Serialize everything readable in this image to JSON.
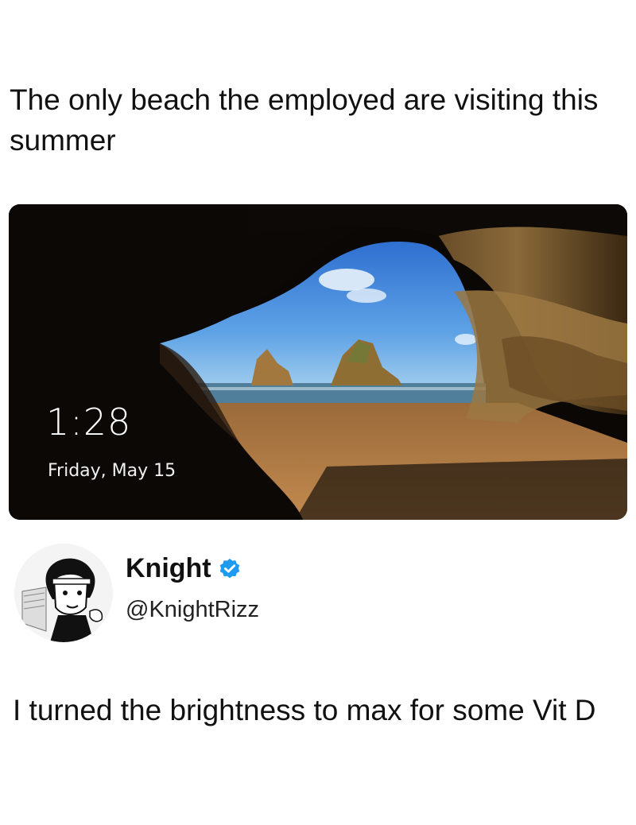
{
  "post": {
    "caption": "The only beach the employed are visiting this summer"
  },
  "lockscreen": {
    "time": "1:28",
    "date": "Friday, May 15"
  },
  "tweet": {
    "display_name": "Knight",
    "handle": "@KnightRizz",
    "verified_color": "#1d9bf0",
    "text": "I turned the brightness to max for some Vit D"
  },
  "icons": [
    "verified-badge-icon"
  ]
}
